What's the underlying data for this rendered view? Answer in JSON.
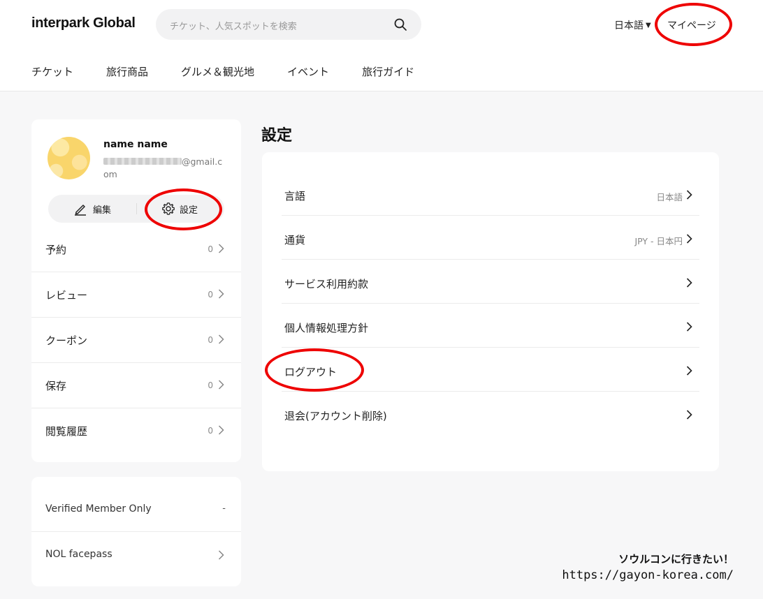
{
  "header": {
    "logo": "interpark Global",
    "search_placeholder": "チケット、人気スポットを検索",
    "language": "日本語",
    "mypage": "マイページ"
  },
  "nav": [
    "チケット",
    "旅行商品",
    "グルメ＆観光地",
    "イベント",
    "旅行ガイド"
  ],
  "profile": {
    "name": "name name",
    "email_suffix": "@gmail.com",
    "edit_label": "編集",
    "settings_label": "設定"
  },
  "menu": [
    {
      "label": "予約",
      "count": "0"
    },
    {
      "label": "レビュー",
      "count": "0"
    },
    {
      "label": "クーポン",
      "count": "0"
    },
    {
      "label": "保存",
      "count": "0"
    },
    {
      "label": "閲覧履歴",
      "count": "0"
    }
  ],
  "extra": [
    {
      "label": "Verified Member Only",
      "value": "-"
    },
    {
      "label": "NOL facepass",
      "value": ""
    }
  ],
  "settings": {
    "title": "設定",
    "items": [
      {
        "label": "言語",
        "value": "日本語"
      },
      {
        "label": "通貨",
        "value": "JPY - 日本円"
      },
      {
        "label": "サービス利用約款",
        "value": ""
      },
      {
        "label": "個人情報処理方針",
        "value": ""
      },
      {
        "label": "ログアウト",
        "value": ""
      },
      {
        "label": "退会(アカウント削除)",
        "value": ""
      }
    ]
  },
  "watermark": {
    "line1": "ソウルコンに行きたい！",
    "line2": "https://gayon-korea.com/"
  },
  "colors": {
    "annotation": "#e00000",
    "background": "#f7f7f8"
  }
}
